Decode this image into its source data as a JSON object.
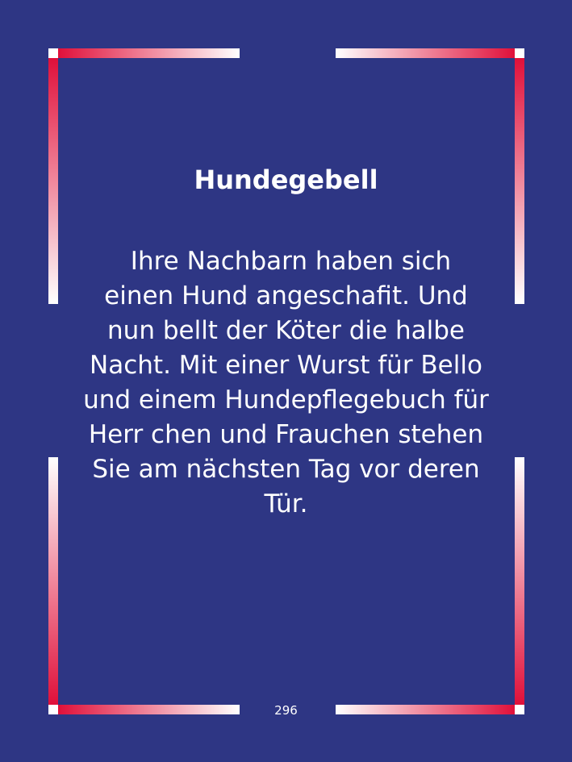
{
  "card": {
    "title": "Hundegebell",
    "body_lines": [
      "Ihre Nachbarn haben sich",
      "einen Hund angeschafit. Und",
      "nun bellt der Köter die halbe",
      "Nacht. Mit einer Wurst für Bello",
      "und einem Hundepflegebuch für",
      "Herr chen und Frauchen stehen",
      "Sie am nächsten Tag vor deren",
      "Tür."
    ],
    "page_number": "296"
  },
  "colors": {
    "background": "#2e3684",
    "frame_red": "#e0103a",
    "frame_white": "#ffffff",
    "text": "#ffffff"
  }
}
